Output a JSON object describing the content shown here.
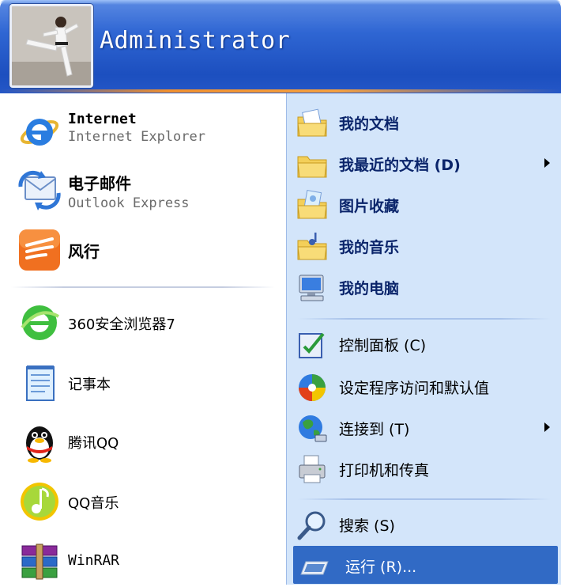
{
  "user": {
    "name": "Administrator"
  },
  "pinned": [
    {
      "title": "Internet",
      "subtitle": "Internet Explorer",
      "icon": "internet-explorer-icon"
    },
    {
      "title": "电子邮件",
      "subtitle": "Outlook Express",
      "icon": "outlook-express-icon"
    },
    {
      "title": "风行",
      "icon": "funshion-icon"
    }
  ],
  "recent": [
    {
      "label": "360安全浏览器7",
      "icon": "360-browser-icon"
    },
    {
      "label": "记事本",
      "icon": "notepad-icon"
    },
    {
      "label": "腾讯QQ",
      "icon": "qq-penguin-icon"
    },
    {
      "label": "QQ音乐",
      "icon": "qq-music-icon"
    },
    {
      "label": "WinRAR",
      "icon": "winrar-icon"
    }
  ],
  "places": [
    {
      "label": "我的文档",
      "icon": "my-documents-icon"
    },
    {
      "label": "我最近的文档 (D)",
      "icon": "recent-documents-icon",
      "submenu": true
    },
    {
      "label": "图片收藏",
      "icon": "my-pictures-icon"
    },
    {
      "label": "我的音乐",
      "icon": "my-music-icon"
    },
    {
      "label": "我的电脑",
      "icon": "my-computer-icon"
    }
  ],
  "system": [
    {
      "label": "控制面板 (C)",
      "icon": "control-panel-icon"
    },
    {
      "label": "设定程序访问和默认值",
      "icon": "program-defaults-icon"
    },
    {
      "label": "连接到 (T)",
      "icon": "connect-to-icon",
      "submenu": true
    },
    {
      "label": "打印机和传真",
      "icon": "printers-icon"
    }
  ],
  "tools": [
    {
      "label": "搜索 (S)",
      "icon": "search-icon"
    },
    {
      "label": "运行 (R)...",
      "icon": "run-icon",
      "selected": true
    }
  ],
  "colors": {
    "header": "#2f66d3",
    "right_panel": "#d3e5fa",
    "selection": "#316ac5"
  }
}
